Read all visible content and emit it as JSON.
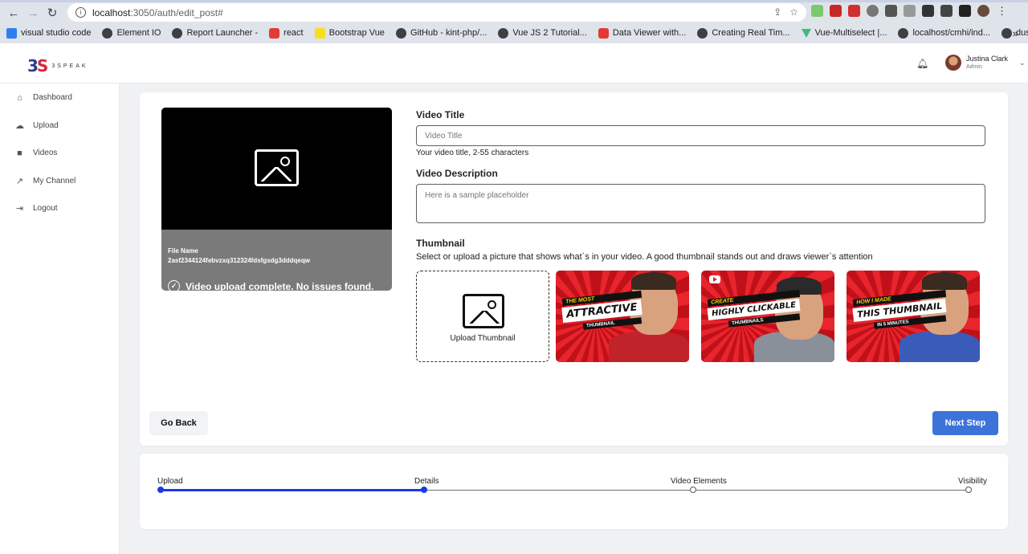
{
  "browser": {
    "url_host": "localhost",
    "url_path": ":3050/auth/edit_post#",
    "bookmarks": [
      {
        "label": "visual studio code",
        "icon": "vscode-icon"
      },
      {
        "label": "Element IO",
        "icon": "globe-icon"
      },
      {
        "label": "Report Launcher -",
        "icon": "globe-icon"
      },
      {
        "label": "react",
        "icon": "youtube-icon"
      },
      {
        "label": "Bootstrap Vue",
        "icon": "js-icon"
      },
      {
        "label": "GitHub - kint-php/...",
        "icon": "globe-icon"
      },
      {
        "label": "Vue JS 2 Tutorial...",
        "icon": "globe-icon"
      },
      {
        "label": "Data Viewer with...",
        "icon": "youtube-icon"
      },
      {
        "label": "Creating Real Tim...",
        "icon": "globe-icon"
      },
      {
        "label": "Vue-Multiselect |...",
        "icon": "vue-icon"
      },
      {
        "label": "localhost/cmhi/ind...",
        "icon": "globe-icon"
      },
      {
        "label": "dusterio/lumen-pa...",
        "icon": "globe-icon"
      }
    ],
    "more": "»"
  },
  "header": {
    "logo_mark_a": "3",
    "logo_mark_b": "S",
    "logo_word": "3SPEAK",
    "user_name": "Justina Clark",
    "user_role": "Admin"
  },
  "sidebar": {
    "items": [
      {
        "label": "Dashboard",
        "icon": "home-icon"
      },
      {
        "label": "Upload",
        "icon": "cloud-upload-icon"
      },
      {
        "label": "Videos",
        "icon": "video-camera-icon"
      },
      {
        "label": "My Channel",
        "icon": "external-link-icon"
      },
      {
        "label": "Logout",
        "icon": "logout-icon"
      }
    ]
  },
  "preview": {
    "file_name_label": "File Name",
    "file_name_value": "2asf2344124febvzxq312324fdsfgsdg3dddqeqw",
    "status": "Video upload complete. No issues found."
  },
  "form": {
    "title_label": "Video Title",
    "title_placeholder": "Video Title",
    "title_hint": "Your video title, 2-55 characters",
    "description_label": "Video Description",
    "description_placeholder": "Here is a sample placeholder",
    "thumbnail_label": "Thumbnail",
    "thumbnail_hint": "Select or upload a picture that shows what`s in your video. A good thumbnail stands out and draws viewer`s attention",
    "upload_thumbnail": "Upload Thumbnail"
  },
  "thumbnails": [
    {
      "small": "THE MOST",
      "big": "ATTRACTIVE",
      "sub": "THUMBNAIL",
      "shirt_color": "#c0242a"
    },
    {
      "small": "CREATE",
      "big": "HIGHLY CLICKABLE",
      "sub": "THUMBNAILS",
      "shirt_color": "#8a9099"
    },
    {
      "small": "HOW I MADE",
      "big": "THIS THUMBNAIL",
      "sub": "IN 5 MINUTES",
      "shirt_color": "#3a5bb8"
    }
  ],
  "actions": {
    "back": "Go Back",
    "next": "Next Step"
  },
  "stepper": {
    "steps": [
      "Upload",
      "Details",
      "Video Elements",
      "Visibility"
    ],
    "completed_through_index": 1
  },
  "colors": {
    "primary": "#3b73d9",
    "progress": "#1a39e8"
  }
}
